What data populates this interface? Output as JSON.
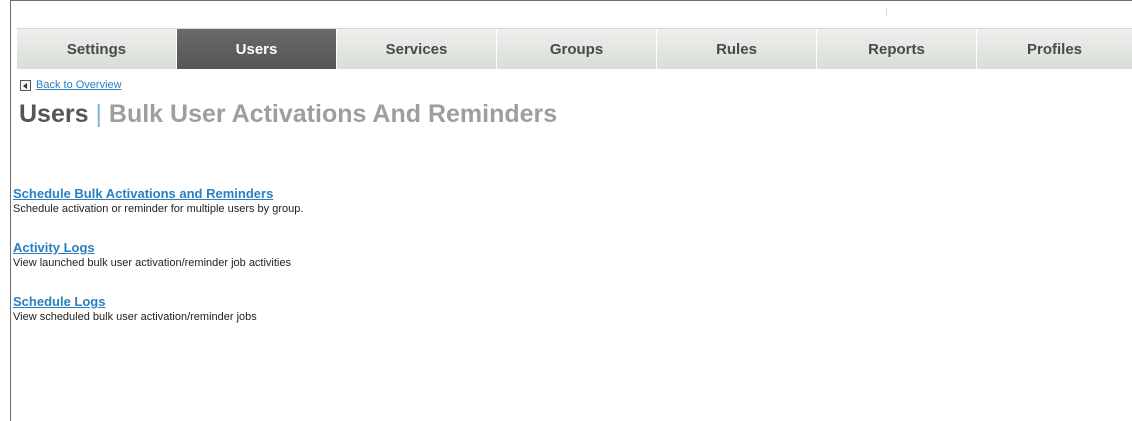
{
  "nav": {
    "tabs": [
      {
        "label": "Settings",
        "active": false
      },
      {
        "label": "Users",
        "active": true
      },
      {
        "label": "Services",
        "active": false
      },
      {
        "label": "Groups",
        "active": false
      },
      {
        "label": "Rules",
        "active": false
      },
      {
        "label": "Reports",
        "active": false
      },
      {
        "label": "Profiles",
        "active": false
      }
    ]
  },
  "back_link": {
    "label": "Back to Overview",
    "icon": "back-arrow-icon"
  },
  "page_title": {
    "main": "Users",
    "separator": "|",
    "sub": "Bulk User Activations And Reminders"
  },
  "entries": [
    {
      "link": "Schedule Bulk Activations and Reminders",
      "description": "Schedule activation or reminder for multiple users by group."
    },
    {
      "link": "Activity Logs",
      "description": "View launched bulk user activation/reminder job activities"
    },
    {
      "link": "Schedule Logs",
      "description": "View scheduled bulk user activation/reminder jobs"
    }
  ],
  "colors": {
    "link": "#2a7fc1",
    "active_tab": "#5f5f5f",
    "tab": "#e3e7e2"
  }
}
